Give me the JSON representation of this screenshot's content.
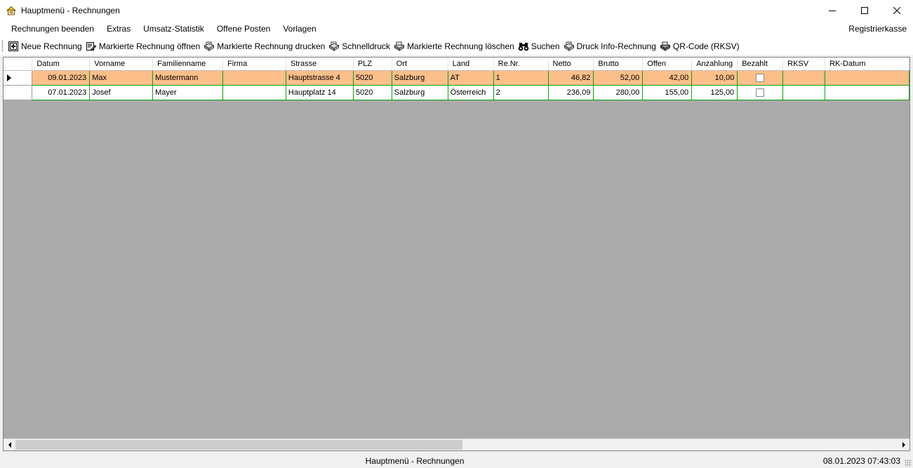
{
  "window": {
    "title": "Hauptmenü - Rechnungen",
    "app_icon": "house-icon",
    "controls": [
      "minimize-icon",
      "maximize-icon",
      "close-icon"
    ]
  },
  "menu": {
    "items": [
      "Rechnungen beenden",
      "Extras",
      "Umsatz-Statistik",
      "Offene Posten",
      "Vorlagen"
    ],
    "right_item": "Registrierkasse"
  },
  "toolbar": {
    "buttons": [
      {
        "label": "Neue Rechnung",
        "icon": "new-document-icon"
      },
      {
        "label": "Markierte Rechnung öffnen",
        "icon": "edit-document-icon"
      },
      {
        "label": "Markierte Rechnung drucken",
        "icon": "print-icon"
      },
      {
        "label": "Schnelldruck",
        "icon": "quick-print-icon"
      },
      {
        "label": "Markierte Rechnung löschen",
        "icon": "delete-document-icon"
      },
      {
        "label": "Suchen",
        "icon": "binoculars-icon"
      },
      {
        "label": "Druck Info-Rechnung",
        "icon": "print-info-icon"
      },
      {
        "label": "QR-Code (RKSV)",
        "icon": "qr-print-icon"
      }
    ]
  },
  "grid": {
    "columns": [
      "Datum",
      "Vorname",
      "Familienname",
      "Firma",
      "Strasse",
      "PLZ",
      "Ort",
      "Land",
      "Re.Nr.",
      "Netto",
      "Brutto",
      "Offen",
      "Anzahlung",
      "Bezahlt",
      "RKSV",
      "RK-Datum"
    ],
    "rows": [
      {
        "datum": "09.01.2023",
        "vorname": "Max",
        "familienname": "Mustermann",
        "firma": "",
        "strasse": "Hauptstrasse 4",
        "plz": "5020",
        "ort": "Salzburg",
        "land": "AT",
        "renr": "1",
        "netto": "46,82",
        "brutto": "52,00",
        "offen": "42,00",
        "anzahlung": "10,00",
        "bezahlt": false,
        "rksv": "",
        "rkdatum": ""
      },
      {
        "datum": "07.01.2023",
        "vorname": "Josef",
        "familienname": "Mayer",
        "firma": "",
        "strasse": "Hauptplatz 14",
        "plz": "5020",
        "ort": "Salzburg",
        "land": "Österreich",
        "renr": "2",
        "netto": "236,09",
        "brutto": "280,00",
        "offen": "155,00",
        "anzahlung": "125,00",
        "bezahlt": false,
        "rksv": "",
        "rkdatum": ""
      }
    ],
    "selected_row": 0,
    "selection_color": "#fdbf8a",
    "grid_line_color": "#0fa00f",
    "empty_area_color": "#ababab"
  },
  "statusbar": {
    "center_text": "Hauptmenü - Rechnungen",
    "datetime": "08.01.2023 07:43:03"
  }
}
